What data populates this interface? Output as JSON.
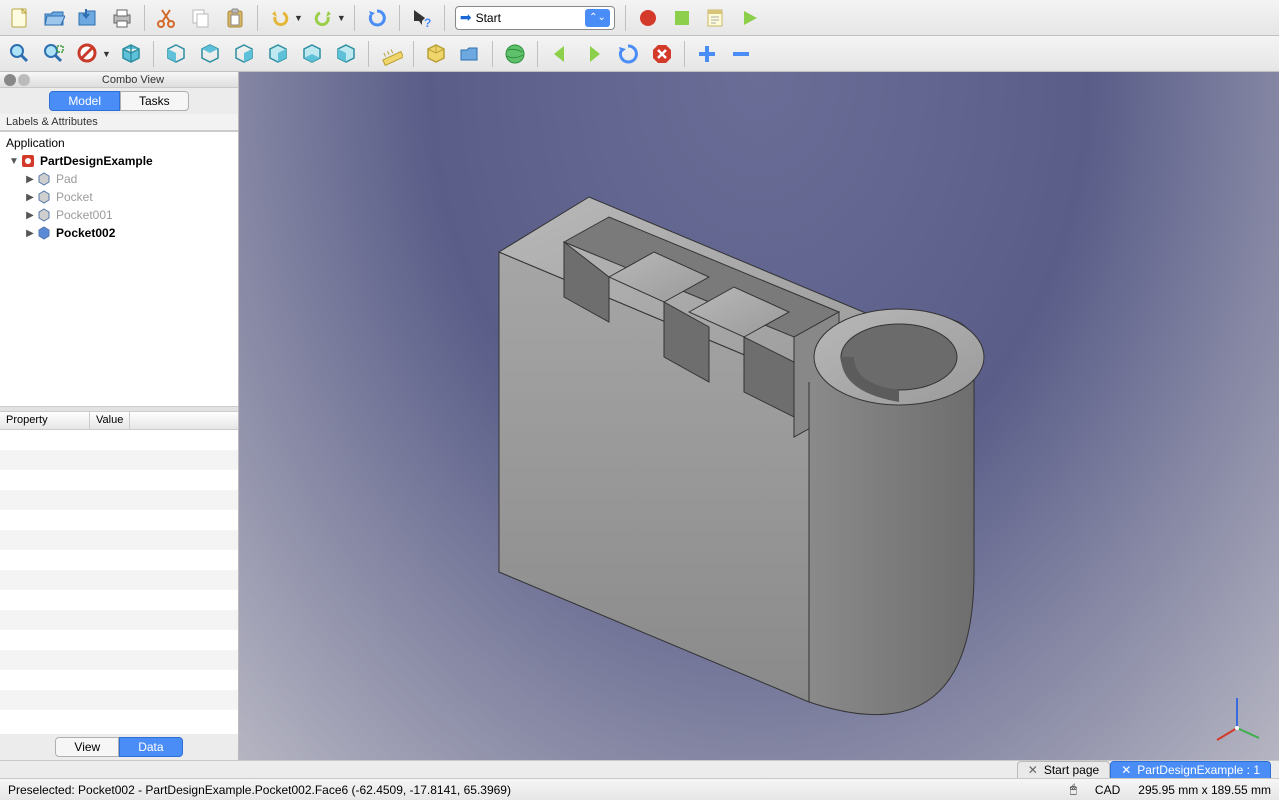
{
  "toolbar1": {
    "icons": [
      "new-file-icon",
      "open-file-icon",
      "save-icon",
      "print-icon",
      "cut-icon",
      "copy-icon",
      "paste-icon",
      "undo-icon",
      "redo-icon",
      "refresh-icon",
      "whatsthis-icon"
    ],
    "macro_selector": {
      "selected": "Start"
    },
    "macro_icons": [
      "record-macro-icon",
      "stop-macro-icon",
      "edit-macro-icon",
      "run-macro-icon"
    ]
  },
  "toolbar2": {
    "icons": [
      "fit-all-icon",
      "fit-selection-icon",
      "draw-style-icon",
      "axonometric-icon",
      "front-icon",
      "top-icon",
      "right-icon",
      "rear-icon",
      "bottom-icon",
      "left-icon",
      "measure-icon",
      "part-icon",
      "group-folder-icon",
      "web-icon",
      "nav-back-icon",
      "nav-forward-icon",
      "nav-refresh-icon",
      "nav-stop-icon",
      "zoom-in-icon",
      "zoom-out-icon"
    ]
  },
  "combo": {
    "title": "Combo View",
    "tabs": {
      "model": "Model",
      "tasks": "Tasks",
      "active": "model"
    },
    "tree_header": "Labels & Attributes",
    "root": "Application",
    "doc_name": "PartDesignExample",
    "items": [
      {
        "label": "Pad",
        "dim": true
      },
      {
        "label": "Pocket",
        "dim": true
      },
      {
        "label": "Pocket001",
        "dim": true
      },
      {
        "label": "Pocket002",
        "dim": false,
        "bold": true
      }
    ],
    "prop_headers": {
      "property": "Property",
      "value": "Value"
    },
    "bottom_tabs": {
      "view": "View",
      "data": "Data",
      "active": "data"
    }
  },
  "doc_tabs": [
    {
      "label": "Start page",
      "active": false
    },
    {
      "label": "PartDesignExample : 1",
      "active": true
    }
  ],
  "status": {
    "preselected": "Preselected: Pocket002 - PartDesignExample.Pocket002.Face6 (-62.4509, -17.8141, 65.3969)",
    "mode": "CAD",
    "dimensions": "295.95 mm x 189.55 mm"
  },
  "colors": {
    "accent": "#4a8df6"
  }
}
